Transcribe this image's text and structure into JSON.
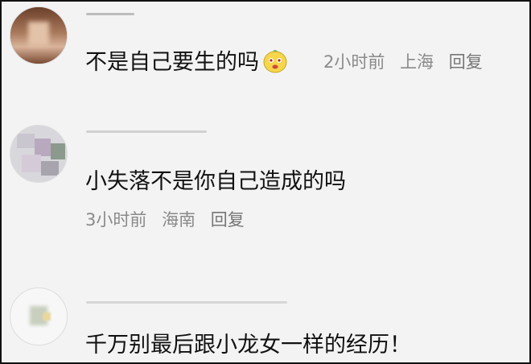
{
  "comments": [
    {
      "text": "不是自己要生的吗",
      "time": "2小时前",
      "location": "上海",
      "reply": "回复",
      "emoji": "yellow-face-emoji"
    },
    {
      "text": "小失落不是你自己造成的吗",
      "time": "3小时前",
      "location": "海南",
      "reply": "回复"
    },
    {
      "text": "千万别最后跟小龙女一样的经历！"
    }
  ]
}
